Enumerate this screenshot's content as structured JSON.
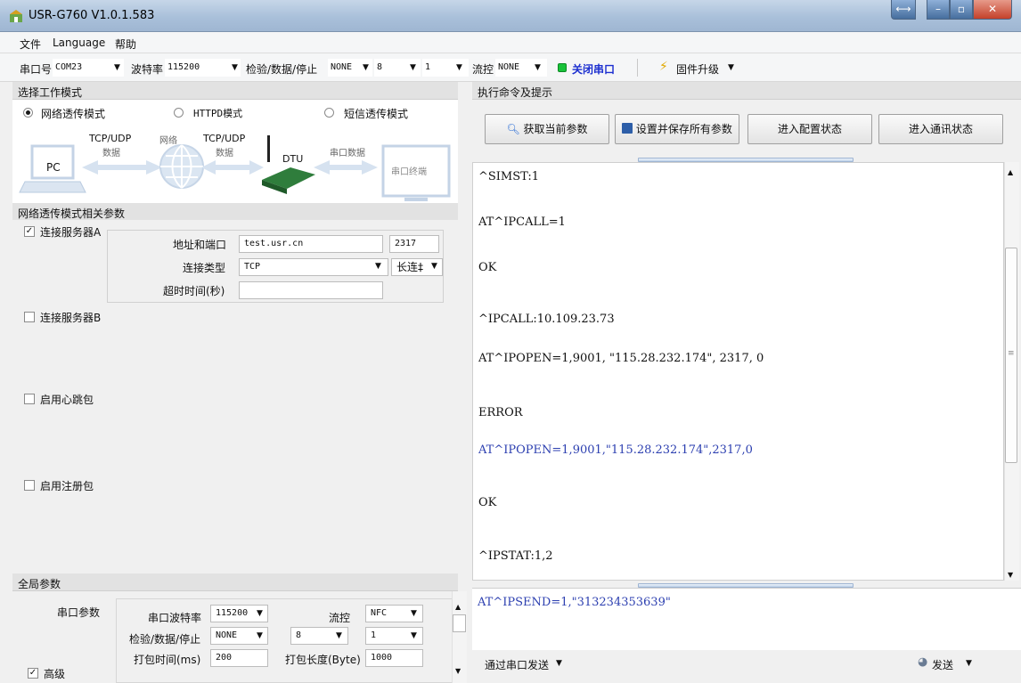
{
  "window": {
    "title": "USR-G760 V1.0.1.583"
  },
  "menu": {
    "file": "文件",
    "language": "Language",
    "help": "帮助"
  },
  "toolbar": {
    "port_label": "串口号",
    "port_value": "COM23",
    "baud_label": "波特率",
    "baud_value": "115200",
    "check_label": "检验/数据/停止",
    "parity_value": "NONE",
    "data_bits_value": "8",
    "stop_bits_value": "1",
    "flow_label": "流控",
    "flow_value": "NONE",
    "close_port_label": "关闭串口",
    "firmware_label": "固件升级",
    "status_color": "#19c23a"
  },
  "mode_section": {
    "header": "选择工作模式",
    "options": [
      "网络透传模式",
      "HTTPD模式",
      "短信透传模式"
    ],
    "selected": 0,
    "diagram": {
      "pc": "PC",
      "tcp_udp_1": "TCP/UDP",
      "data_1": "数据",
      "network": "网络",
      "tcp_udp_2": "TCP/UDP",
      "data_2": "数据",
      "dtu": "DTU",
      "serial_data": "串口数据",
      "serial_terminal": "串口终端"
    }
  },
  "net_section": {
    "header": "网络透传模式相关参数",
    "serverA_label": "连接服务器A",
    "serverA_checked": true,
    "addr_label": "地址和端口",
    "addr_value": "test.usr.cn",
    "port_value": "2317",
    "conn_type_label": "连接类型",
    "conn_type_value": "TCP",
    "conn_mode_value": "长连‡",
    "timeout_label": "超时时间(秒)",
    "timeout_value": "",
    "serverB_label": "连接服务器B",
    "heartbeat_label": "启用心跳包",
    "register_label": "启用注册包"
  },
  "global_section": {
    "header": "全局参数",
    "serial_params_label": "串口参数",
    "baud_label": "串口波特率",
    "baud_value": "115200",
    "flow_label": "流控",
    "flow_value": "NFC",
    "check_label": "检验/数据/停止",
    "parity_value": "NONE",
    "data_value": "8",
    "stop_value": "1",
    "pack_time_label": "打包时间(ms)",
    "pack_time_value": "200",
    "pack_len_label": "打包长度(Byte)",
    "pack_len_value": "1000",
    "advanced_label": "高级"
  },
  "right": {
    "header": "执行命令及提示",
    "buttons": [
      "获取当前参数",
      "设置并保存所有参数",
      "进入配置状态",
      "进入通讯状态"
    ],
    "console_lines": [
      {
        "text": "^SIMST:1",
        "sent": false
      },
      {
        "text": "AT^IPCALL=1",
        "sent": false
      },
      {
        "text": "OK",
        "sent": false
      },
      {
        "text": "^IPCALL:10.109.23.73",
        "sent": false
      },
      {
        "text": "AT^IPOPEN=1,9001, \"115.28.232.174\", 2317, 0",
        "sent": false
      },
      {
        "text": "ERROR",
        "sent": false
      },
      {
        "text": "AT^IPOPEN=1,9001,\"115.28.232.174\",2317,0",
        "sent": true
      },
      {
        "text": "OK",
        "sent": false
      },
      {
        "text": "^IPSTAT:1,2",
        "sent": false
      }
    ],
    "send_text": "AT^IPSEND=1,\"313234353639\"",
    "send_via_label": "通过串口发送",
    "send_label": "发送"
  }
}
